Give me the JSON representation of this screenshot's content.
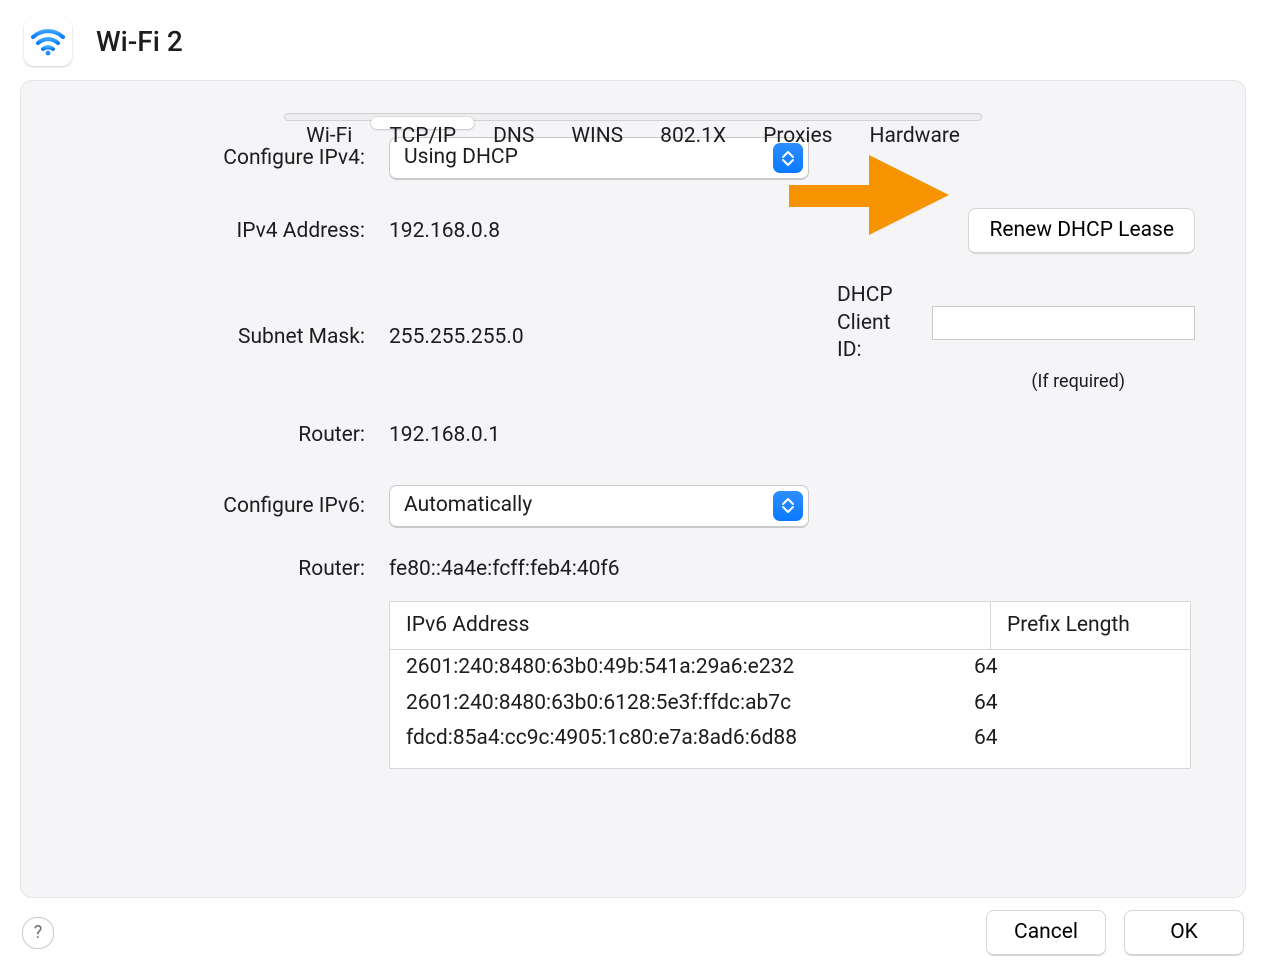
{
  "header": {
    "title": "Wi-Fi 2"
  },
  "tabs": [
    "Wi-Fi",
    "TCP/IP",
    "DNS",
    "WINS",
    "802.1X",
    "Proxies",
    "Hardware"
  ],
  "active_tab_index": 1,
  "ipv4": {
    "configure_label": "Configure IPv4:",
    "configure_value": "Using DHCP",
    "address_label": "IPv4 Address:",
    "address_value": "192.168.0.8",
    "subnet_label": "Subnet Mask:",
    "subnet_value": "255.255.255.0",
    "router_label": "Router:",
    "router_value": "192.168.0.1",
    "renew_button": "Renew DHCP Lease",
    "client_id_label": "DHCP Client ID:",
    "client_id_value": "",
    "client_id_note": "(If required)"
  },
  "ipv6": {
    "configure_label": "Configure IPv6:",
    "configure_value": "Automatically",
    "router_label": "Router:",
    "router_value": "fe80::4a4e:fcff:feb4:40f6",
    "table_headers": {
      "address": "IPv6 Address",
      "prefix": "Prefix Length"
    },
    "rows": [
      {
        "address": "2601:240:8480:63b0:49b:541a:29a6:e232",
        "prefix": "64"
      },
      {
        "address": "2601:240:8480:63b0:6128:5e3f:ffdc:ab7c",
        "prefix": "64"
      },
      {
        "address": "fdcd:85a4:cc9c:4905:1c80:e7a:8ad6:6d88",
        "prefix": "64"
      }
    ]
  },
  "footer": {
    "help": "?",
    "cancel": "Cancel",
    "ok": "OK"
  },
  "colors": {
    "accent": "#0a7aff",
    "annotation": "#f59300"
  }
}
